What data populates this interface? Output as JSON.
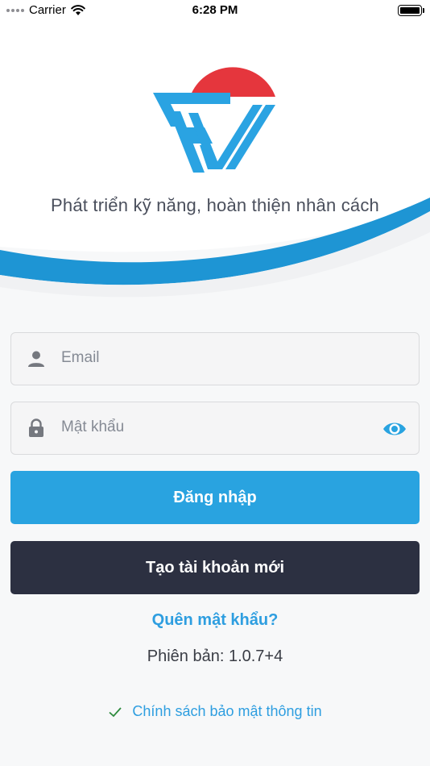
{
  "status_bar": {
    "carrier": "Carrier",
    "time": "6:28 PM"
  },
  "header": {
    "slogan": "Phát triển kỹ năng, hoàn thiện nhân cách"
  },
  "form": {
    "email_placeholder": "Email",
    "password_placeholder": "Mật khẩu",
    "login_label": "Đăng nhập",
    "create_label": "Tạo tài khoản mới",
    "forgot_label": "Quên mật khẩu?"
  },
  "footer": {
    "version": "Phiên bản: 1.0.7+4",
    "policy": "Chính sách bảo mật thông tin"
  },
  "colors": {
    "accent": "#29a3e0",
    "dark_button": "#2c3041",
    "logo_red": "#e5363d",
    "wave_blue": "#1e95d4"
  },
  "icons": [
    "wifi-icon",
    "battery-icon",
    "person-icon",
    "lock-icon",
    "eye-icon",
    "check-icon"
  ]
}
